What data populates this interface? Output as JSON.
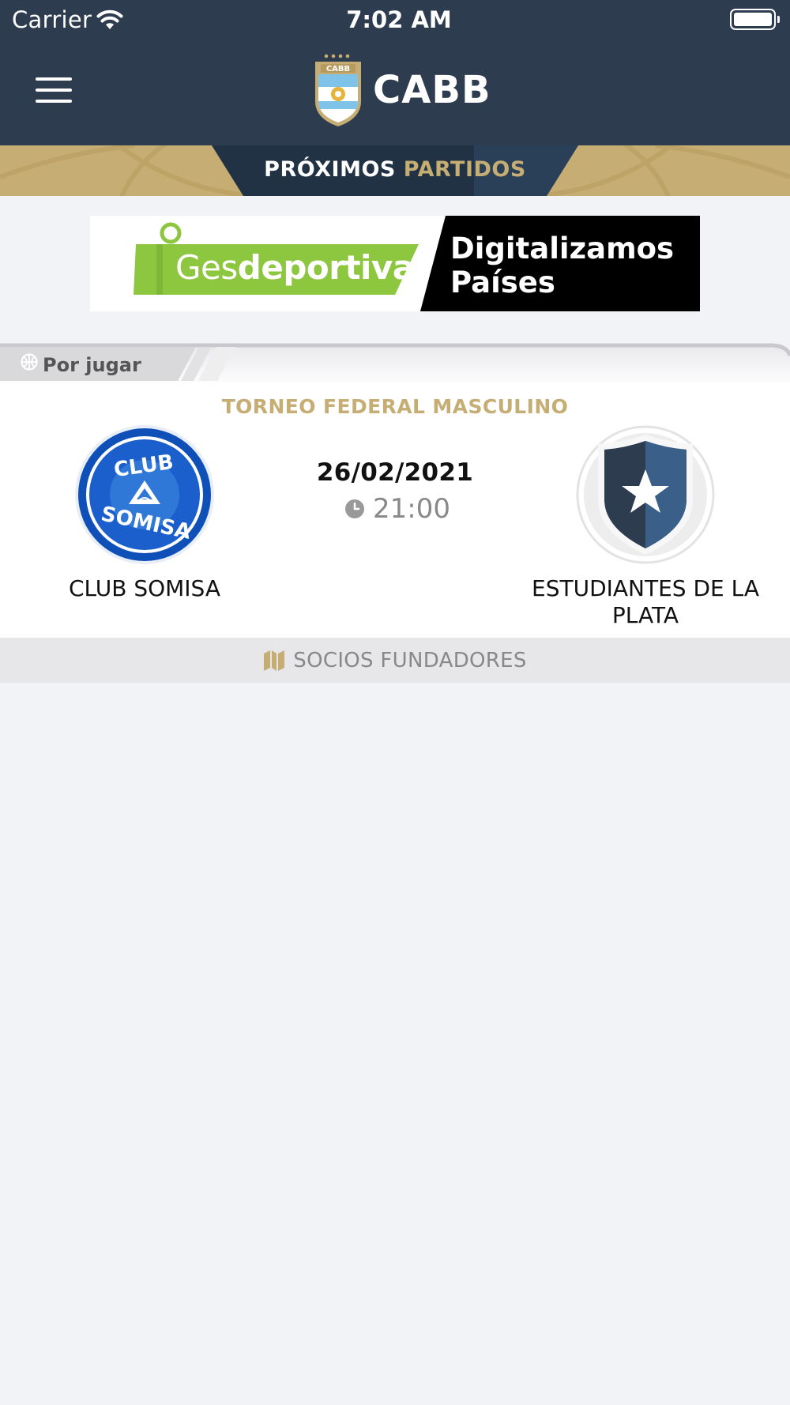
{
  "status_bar": {
    "carrier": "Carrier",
    "time": "7:02 AM"
  },
  "header": {
    "menu_icon": "hamburger-menu-icon",
    "logo_badge_text": "CABB",
    "logo_text": "CABB",
    "background_color": "#2e3c50"
  },
  "section": {
    "title_first": "PRÓXIMOS",
    "title_second": "PARTIDOS",
    "accent_color": "#c6ad73"
  },
  "ad": {
    "brand_light": "Ges",
    "brand_bold": "deportiva",
    "slogan": "Digitalizamos Países",
    "brand_color": "#8dc63f"
  },
  "match": {
    "status": "Por jugar",
    "status_icon": "basketball-icon",
    "tournament": "TORNEO FEDERAL MASCULINO",
    "date": "26/02/2021",
    "time": "21:00",
    "time_icon": "clock-icon",
    "home_team": {
      "name": "CLUB SOMISA",
      "crest_text": "CLUB SOMISA",
      "crest_icon": "club-somisa-crest-icon"
    },
    "away_team": {
      "name": "ESTUDIANTES DE LA PLATA",
      "crest_icon": "shield-star-icon"
    }
  },
  "sponsors": {
    "label": "SOCIOS FUNDADORES",
    "icon": "map-icon"
  }
}
